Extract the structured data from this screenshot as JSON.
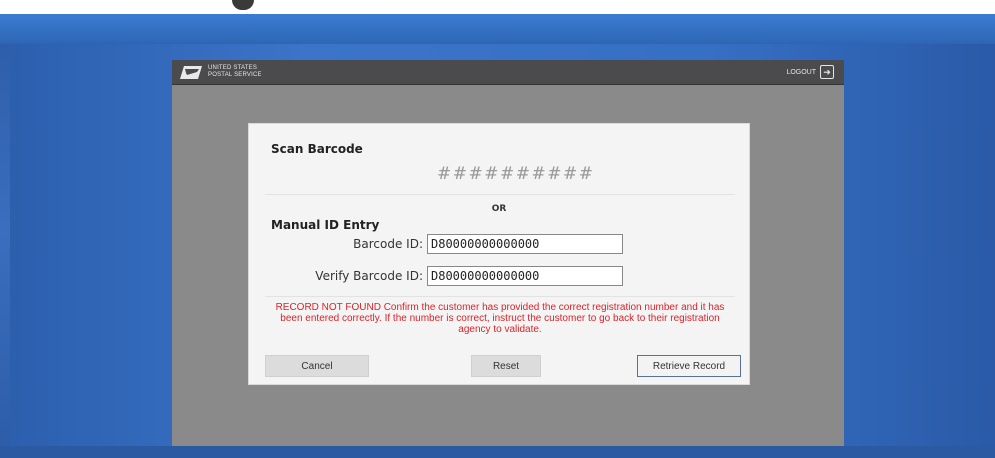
{
  "header": {
    "logo_line1": "UNITED STATES",
    "logo_line2": "POSTAL SERVICE",
    "logout_label": "LOGOUT",
    "logout_icon": "logout-arrow-icon"
  },
  "dialog": {
    "scan_title": "Scan Barcode",
    "scan_placeholder": "##########",
    "or_label": "OR",
    "manual_title": "Manual ID Entry",
    "barcode_label": "Barcode ID:",
    "barcode_value": "D80000000000000",
    "verify_label": "Verify Barcode ID:",
    "verify_value": "D80000000000000",
    "error_text": "RECORD NOT FOUND Confirm the customer has provided the correct registration number and it has been entered correctly. If the number is correct, instruct the customer to go back to their registration agency to validate.",
    "cancel_label": "Cancel",
    "reset_label": "Reset",
    "retrieve_label": "Retrieve Record"
  },
  "colors": {
    "error": "#d8242a",
    "header": "#4b4b4d",
    "kiosk_bg": "#8a8a8a"
  }
}
